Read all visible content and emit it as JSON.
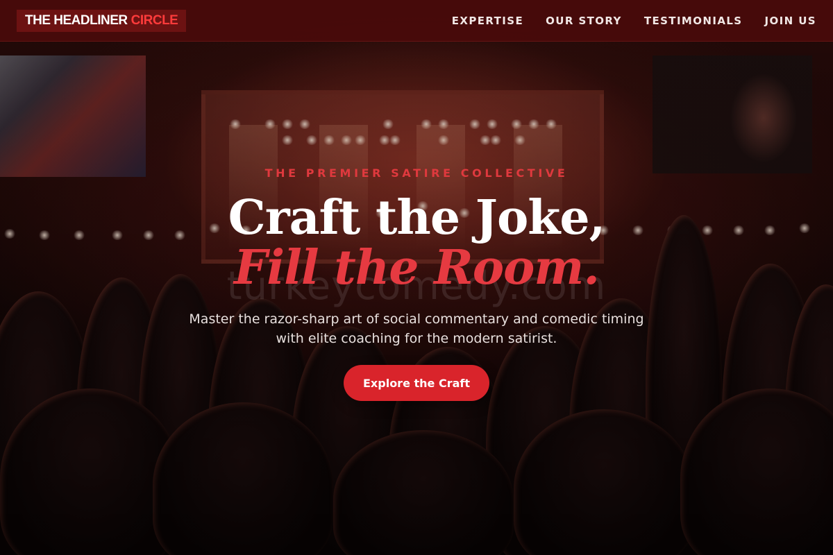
{
  "nav": {
    "logo_white": "THE HEADLINER",
    "logo_red": "CIRCLE",
    "links": [
      "EXPERTISE",
      "OUR STORY",
      "TESTIMONIALS",
      "JOIN US"
    ]
  },
  "hero": {
    "eyebrow": "THE PREMIER SATIRE COLLECTIVE",
    "headline_line1": "Craft the Joke,",
    "headline_line2": "Fill the Room.",
    "watermark": "turkeycomedy.com",
    "subtext": "Master the razor-sharp art of social commentary and comedic timing with elite coaching for the modern satirist.",
    "cta_label": "Explore the Craft"
  },
  "colors": {
    "accent": "#e63a41",
    "nav_bg": "#4b0a0a",
    "cta_bg": "#d9242b",
    "logo_bg": "#6c1212"
  }
}
